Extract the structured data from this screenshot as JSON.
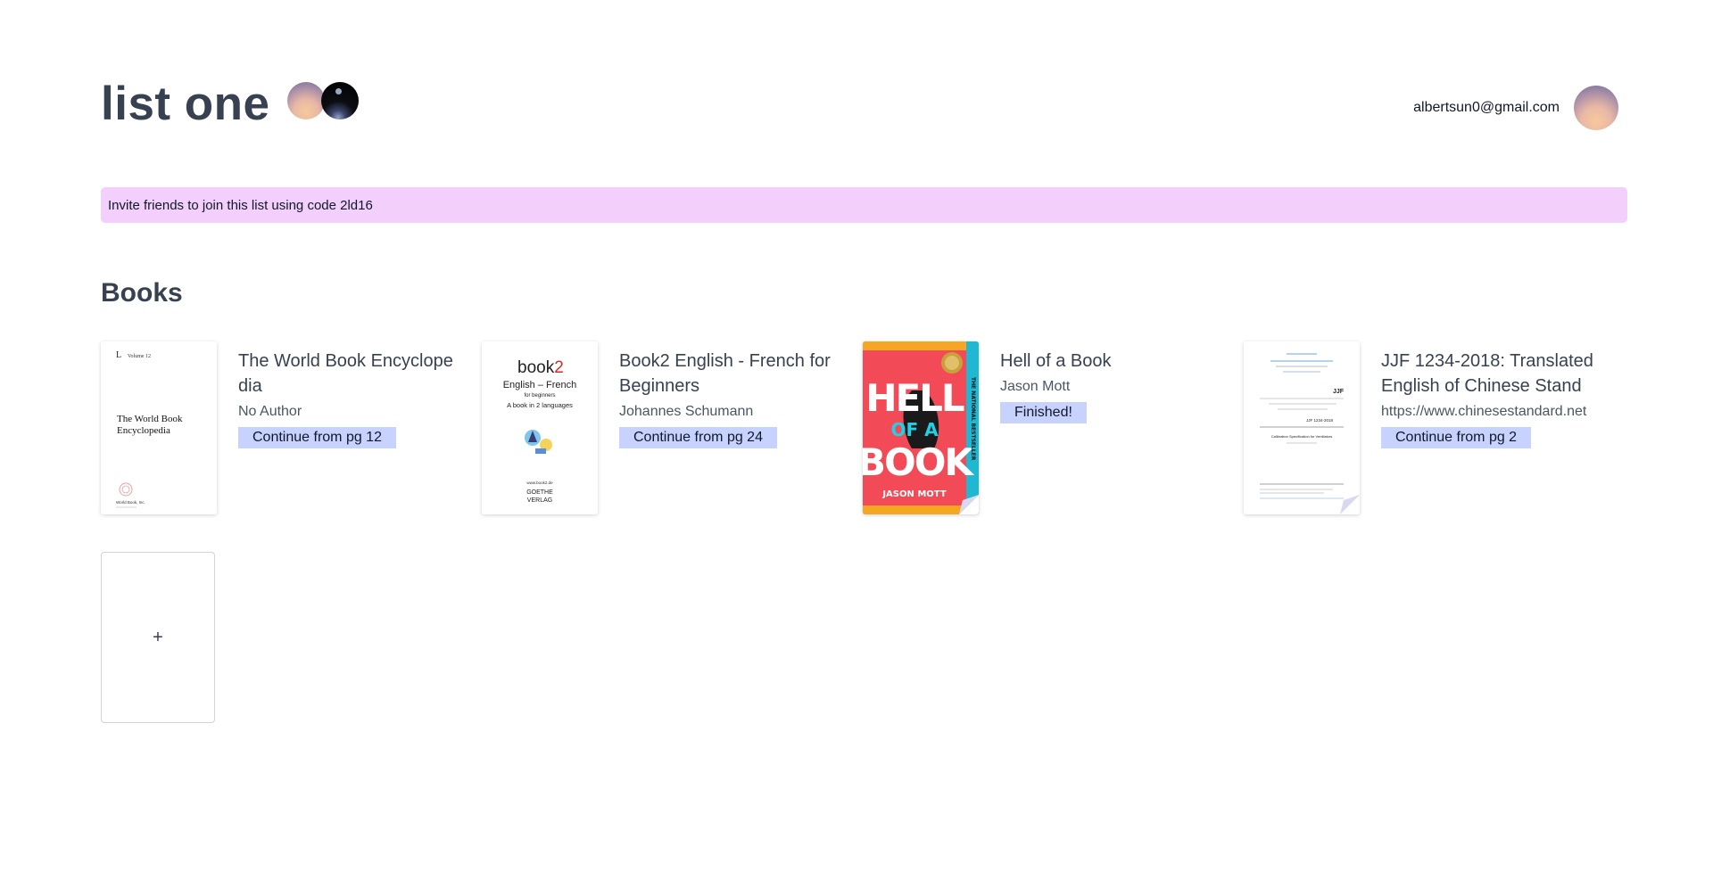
{
  "header": {
    "title": "list one",
    "member_avatars": [
      "sunset-avatar",
      "space-avatar"
    ],
    "user_email": "albertsun0@gmail.com",
    "user_avatar": "sunset-avatar"
  },
  "banner": {
    "text": "Invite friends to join this list using code 2ld16"
  },
  "books_section": {
    "heading": "Books"
  },
  "books": [
    {
      "title": "The World Book Encyclopedia",
      "author": "No Author",
      "status": "Continue from pg 12",
      "cover": {
        "corner": "L",
        "volume": "Volume 12",
        "line1": "The World Book",
        "line2": "Encyclopedia",
        "publisher": "World Book, Inc."
      }
    },
    {
      "title": "Book2 English - French for Beginners",
      "author": "Johannes Schumann",
      "status": "Continue from pg 24",
      "cover": {
        "brand": "book",
        "brand_num": "2",
        "line1": "English – French",
        "line2": "for beginners",
        "line3": "A book in 2 languages",
        "url": "www.book2.de",
        "pub1": "GOETHE",
        "pub2": "VERLAG"
      }
    },
    {
      "title": "Hell of a Book",
      "author": "Jason Mott",
      "status": "Finished!",
      "cover": {
        "w1": "HELL",
        "w2": "OF A",
        "w3": "BOOK",
        "author": "JASON MOTT",
        "spine": "THE NATIONAL BESTSELLER"
      }
    },
    {
      "title": "JJF 1234-2018: Translated English of Chinese Stand",
      "author": "https://www.chinesestandard.net",
      "status": "Continue from pg 2",
      "cover": {
        "code": "JJF",
        "num": "JJF 1234-2018",
        "caption": "Calibration Specification for Ventilators"
      }
    }
  ],
  "add_card": {
    "label": "+"
  },
  "colors": {
    "banner": "#f3d0fb",
    "badge": "#c7d2fe",
    "text": "#374151"
  }
}
